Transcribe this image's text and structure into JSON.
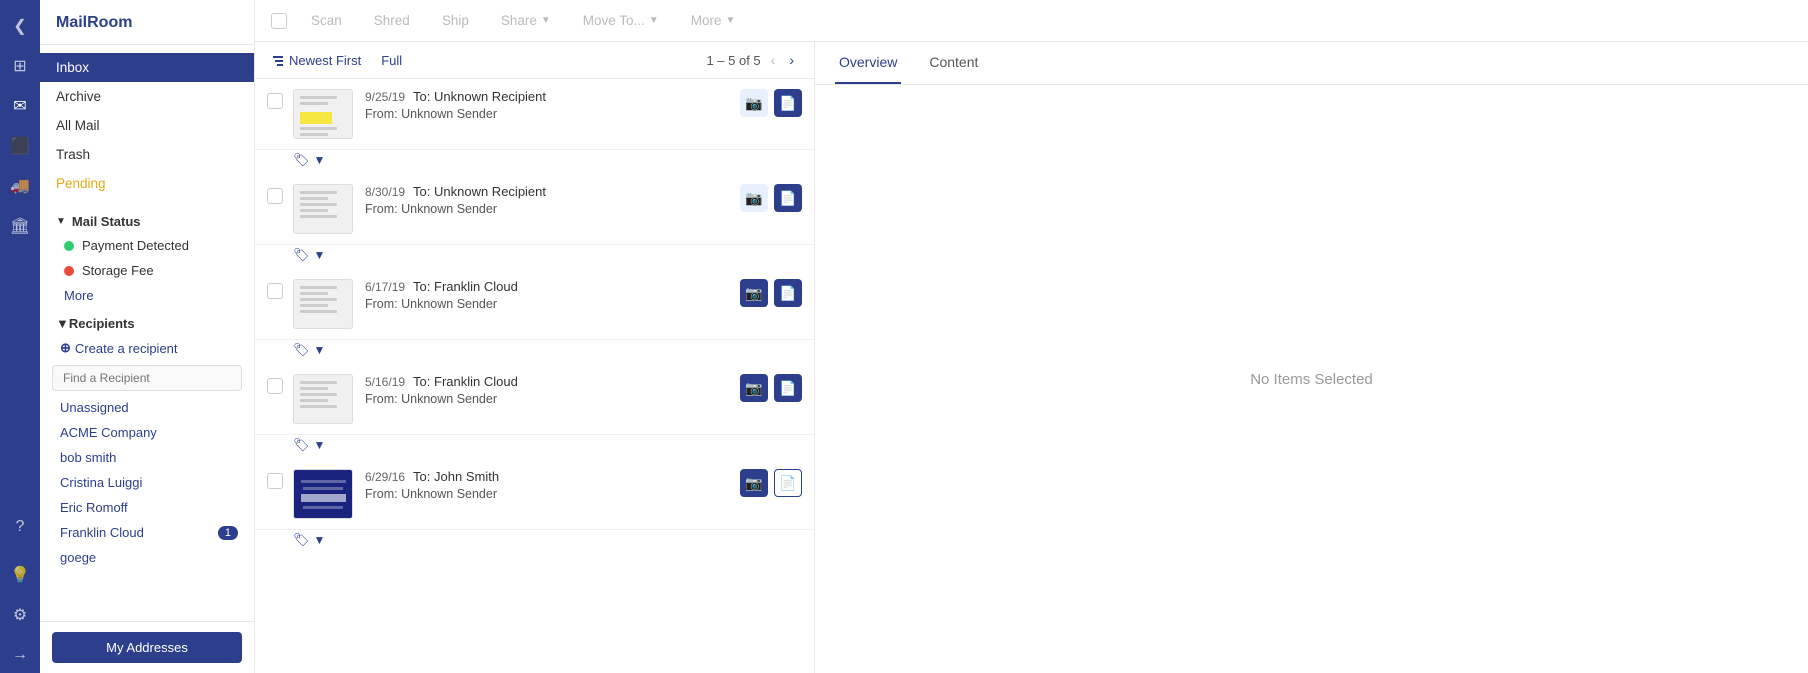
{
  "app": {
    "title": "MailRoom"
  },
  "iconRail": {
    "items": [
      {
        "name": "chevron-icon",
        "icon": "❮",
        "active": false
      },
      {
        "name": "grid-icon",
        "icon": "⊞",
        "active": false
      },
      {
        "name": "mail-icon",
        "icon": "✉",
        "active": true
      },
      {
        "name": "screen-icon",
        "icon": "⬛",
        "active": false
      },
      {
        "name": "truck-icon",
        "icon": "🚚",
        "active": false
      },
      {
        "name": "bank-icon",
        "icon": "🏛",
        "active": false
      },
      {
        "name": "question-icon",
        "icon": "?",
        "active": false
      },
      {
        "name": "bulb-icon",
        "icon": "💡",
        "active": false
      },
      {
        "name": "settings-icon",
        "icon": "⚙",
        "active": false
      },
      {
        "name": "logout-icon",
        "icon": "→",
        "active": false
      }
    ]
  },
  "sidebar": {
    "title": "MailRoom",
    "navItems": [
      {
        "label": "Inbox",
        "active": true
      },
      {
        "label": "Archive",
        "active": false
      },
      {
        "label": "All Mail",
        "active": false
      },
      {
        "label": "Trash",
        "active": false
      },
      {
        "label": "Pending",
        "active": false,
        "pending": true
      }
    ],
    "mailStatusSection": {
      "title": "Mail Status",
      "items": [
        {
          "label": "Payment Detected",
          "dotColor": "green"
        },
        {
          "label": "Storage Fee",
          "dotColor": "red"
        }
      ],
      "moreLabel": "More"
    },
    "recipientsSection": {
      "title": "Recipients",
      "createLabel": "Create a recipient",
      "searchPlaceholder": "Find a Recipient",
      "items": [
        {
          "label": "Unassigned",
          "count": null
        },
        {
          "label": "ACME Company",
          "count": null
        },
        {
          "label": "bob smith",
          "count": null
        },
        {
          "label": "Cristina Luiggi",
          "count": null
        },
        {
          "label": "Eric Romoff",
          "count": null
        },
        {
          "label": "Franklin Cloud",
          "count": 1
        },
        {
          "label": "goege",
          "count": null
        }
      ]
    },
    "myAddressesBtn": "My Addresses"
  },
  "toolbar": {
    "scanLabel": "Scan",
    "shredLabel": "Shred",
    "shipLabel": "Ship",
    "shareLabel": "Share",
    "moveToLabel": "Move To...",
    "moreLabel": "More"
  },
  "mailList": {
    "sortLabel": "Newest First",
    "viewLabel": "Full",
    "pagination": {
      "text": "1 – 5 of 5"
    },
    "items": [
      {
        "date": "9/25/19",
        "to": "To:  Unknown Recipient",
        "from": "From:  Unknown Sender",
        "hasCamera": false,
        "hasDoc": true,
        "thumbType": "lines",
        "hasTag": true
      },
      {
        "date": "8/30/19",
        "to": "To:  Unknown Recipient",
        "from": "From:  Unknown Sender",
        "hasCamera": false,
        "hasDoc": true,
        "thumbType": "lines2",
        "hasTag": true
      },
      {
        "date": "6/17/19",
        "to": "To:  Franklin Cloud",
        "from": "From:  Unknown Sender",
        "hasCamera": true,
        "hasDoc": true,
        "thumbType": "lines2",
        "hasTag": true
      },
      {
        "date": "5/16/19",
        "to": "To:  Franklin Cloud",
        "from": "From:  Unknown Sender",
        "hasCamera": true,
        "hasDoc": true,
        "thumbType": "lines2",
        "hasTag": true
      },
      {
        "date": "6/29/16",
        "to": "To:  John Smith",
        "from": "From:  Unknown Sender",
        "hasCamera": true,
        "hasDoc": true,
        "docOutline": true,
        "thumbType": "dark",
        "hasTag": true
      }
    ]
  },
  "rightPanel": {
    "tabs": [
      {
        "label": "Overview",
        "active": true
      },
      {
        "label": "Content",
        "active": false
      }
    ],
    "emptyMessage": "No Items Selected"
  }
}
